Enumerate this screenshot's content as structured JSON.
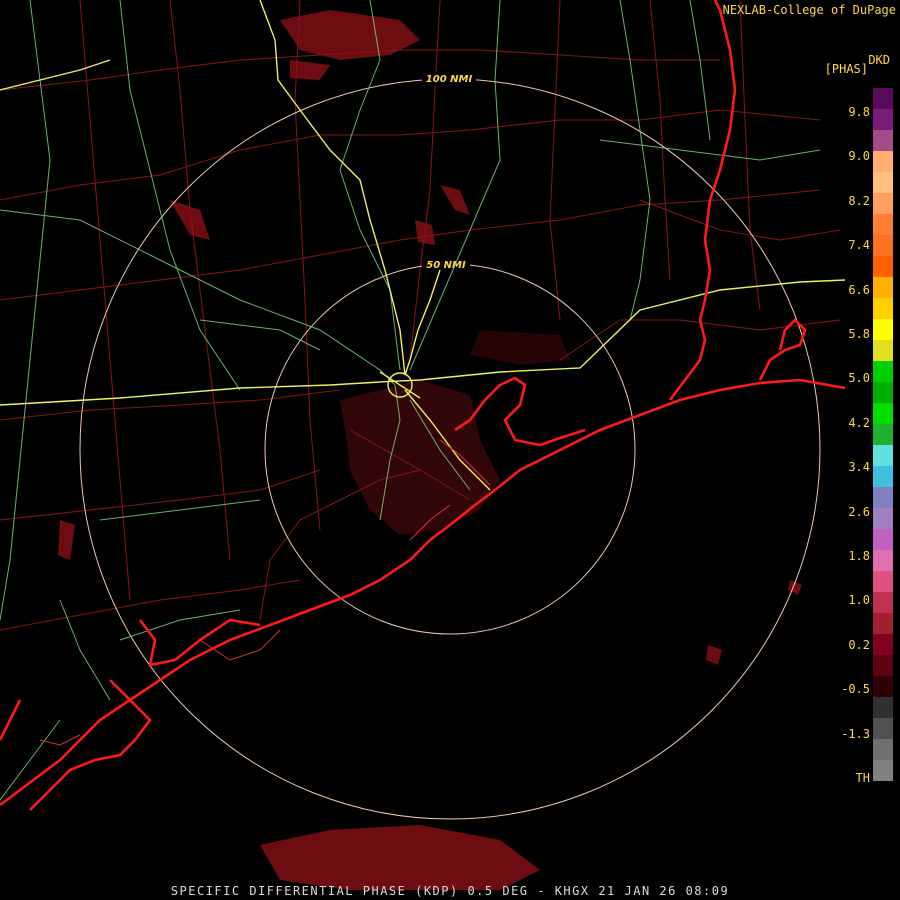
{
  "header": {
    "credit": "NEXLAB-College of DuPage",
    "product_code": "DKD",
    "product_unit": "[PHAS]"
  },
  "footer": {
    "caption": "SPECIFIC DIFFERENTIAL PHASE (KDP) 0.5 DEG - KHGX 21 JAN 26 08:09"
  },
  "range_rings": [
    {
      "label": "50 NMI"
    },
    {
      "label": "100 NMI"
    }
  ],
  "legend": {
    "labels": [
      "9.8",
      "9.0",
      "8.2",
      "7.4",
      "6.6",
      "5.8",
      "5.0",
      "4.2",
      "3.4",
      "2.6",
      "1.8",
      "1.0",
      "0.2",
      "-0.5",
      "-1.3",
      "TH"
    ],
    "colors": [
      "#5a0a5a",
      "#7a1a7a",
      "#a44b8c",
      "#ffb070",
      "#ffc080",
      "#ffa060",
      "#ff8030",
      "#ff7020",
      "#ff6000",
      "#ffb000",
      "#ffd000",
      "#ffff00",
      "#e0e020",
      "#00d000",
      "#00b000",
      "#00e000",
      "#20b030",
      "#60e0e0",
      "#40c0e0",
      "#8080c0",
      "#a080c0",
      "#c060c0",
      "#e070b0",
      "#e05080",
      "#c03050",
      "#a02030",
      "#800020",
      "#600010",
      "#300008",
      "#303030",
      "#505050",
      "#707070",
      "#808080",
      "#000000"
    ]
  }
}
